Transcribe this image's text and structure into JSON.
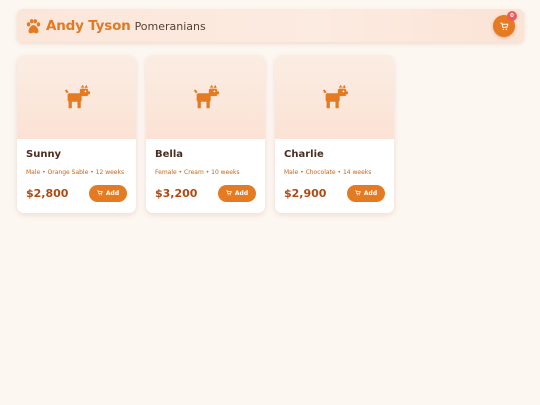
{
  "header": {
    "brand_name": "Andy Tyson",
    "brand_subtitle": "Pomeranians",
    "brand_icon": "paw-icon",
    "cart_icon": "cart-icon",
    "cart_count": "0"
  },
  "colors": {
    "accent": "#e47a22",
    "brand_text": "#e07a24",
    "price": "#b04a12",
    "badge": "#f05a5a",
    "background": "#fdf7f2"
  },
  "pets": [
    {
      "name": "Sunny",
      "meta": "Male • Orange Sable • 12 weeks",
      "price": "$2,800",
      "add_label": "Add",
      "image_icon": "dog-icon"
    },
    {
      "name": "Bella",
      "meta": "Female • Cream • 10 weeks",
      "price": "$3,200",
      "add_label": "Add",
      "image_icon": "dog-icon"
    },
    {
      "name": "Charlie",
      "meta": "Male • Chocolate • 14 weeks",
      "price": "$2,900",
      "add_label": "Add",
      "image_icon": "dog-icon"
    }
  ]
}
